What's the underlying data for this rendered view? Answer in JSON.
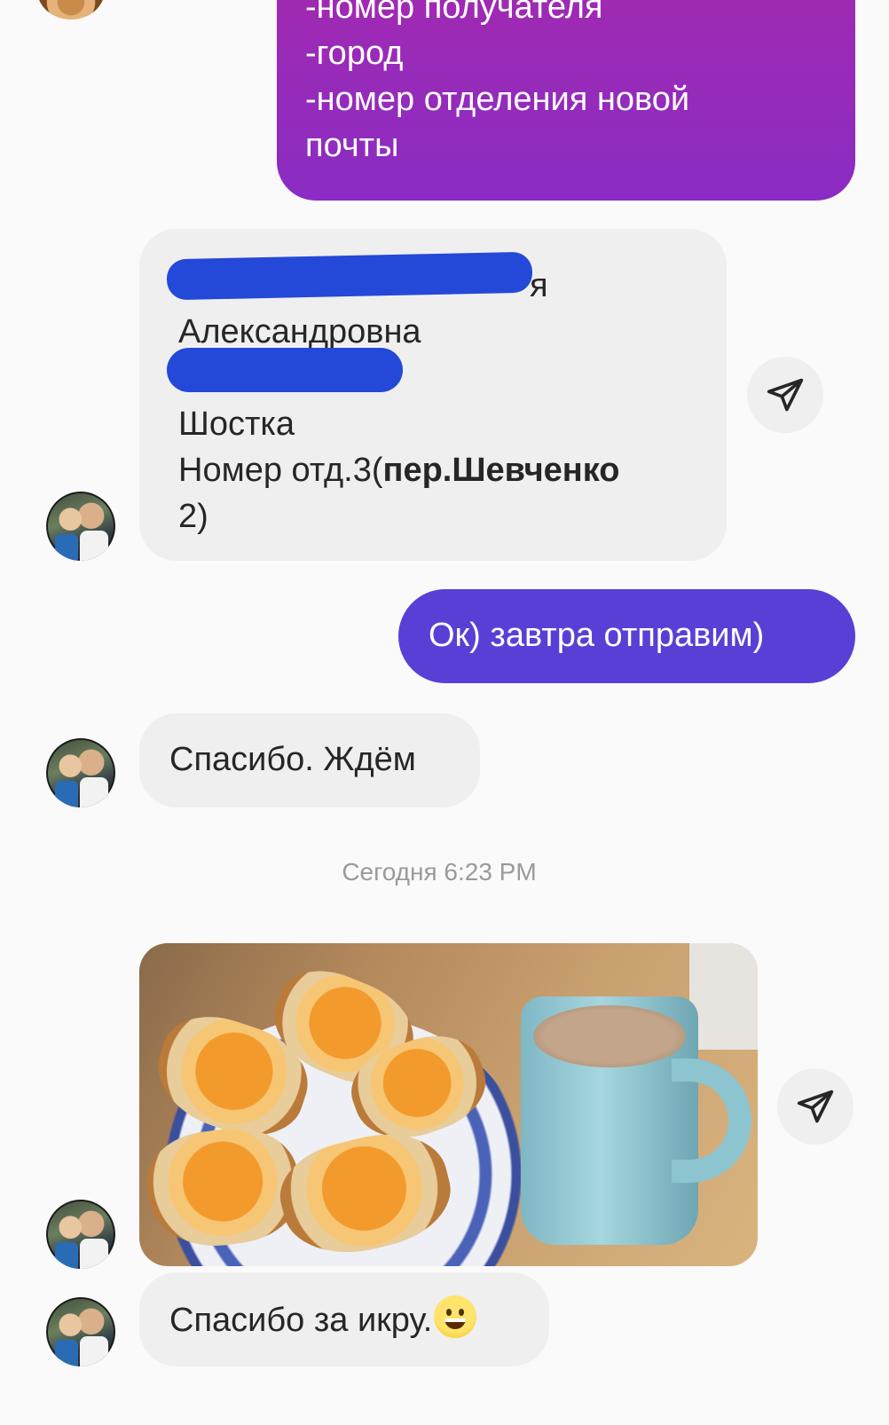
{
  "messages": {
    "outgoing_request": {
      "lines": [
        "-номер получателя",
        "-город",
        "-номер отделения новой",
        "почты"
      ]
    },
    "incoming_address": {
      "line1_suffix": "я",
      "line2": "Александровна",
      "line4": "Шостка",
      "line5_regular": "Номер отд.3(",
      "line5_bold": "пер.Шевченко",
      "line6": "2)"
    },
    "outgoing_ok": "Ок) завтра отправим)",
    "incoming_thanks": "Спасибо. Ждём",
    "timestamp": "Сегодня 6:23 PM",
    "incoming_caviar": "Спасибо за икру."
  },
  "icons": {
    "share": "paper-plane-icon",
    "emoji": "grinning-face-emoji"
  },
  "colors": {
    "outgoing_gradient_top": "#a22ab0",
    "outgoing_gradient_bottom": "#8a2cc4",
    "outgoing_blue": "#5a3fd6",
    "incoming_bg": "#efefef",
    "redaction": "#2448d8"
  }
}
